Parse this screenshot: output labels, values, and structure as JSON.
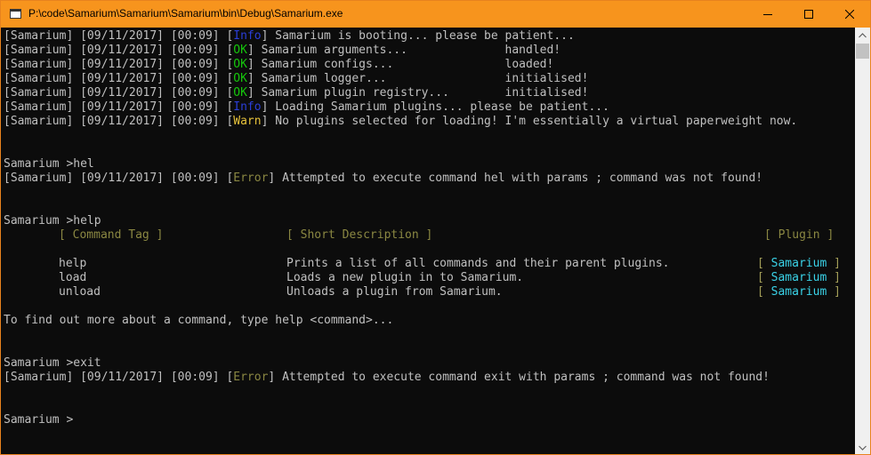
{
  "window": {
    "title": "P:\\code\\Samarium\\Samarium\\Samarium\\bin\\Debug\\Samarium.exe",
    "title_bar_color": "#f7941d",
    "buttons": {
      "minimize": "minimize-icon",
      "maximize": "maximize-icon",
      "close": "close-icon"
    }
  },
  "colors": {
    "info": "#2b3fd9",
    "ok": "#16c60c",
    "warn": "#e6c23a",
    "error": "#8a8742",
    "plugin": "#3ad3e8",
    "text": "#c0c0c0",
    "background": "#0c0c0c"
  },
  "log": {
    "prefix": "[Samarium] [09/11/2017] [00:09] ",
    "boot": [
      {
        "tag": "Info",
        "message": " Samarium is booting... please be patient..."
      },
      {
        "tag": "OK",
        "message": " Samarium arguments...              handled!"
      },
      {
        "tag": "OK",
        "message": " Samarium configs...                loaded!"
      },
      {
        "tag": "OK",
        "message": " Samarium logger...                 initialised!"
      },
      {
        "tag": "OK",
        "message": " Samarium plugin registry...        initialised!"
      },
      {
        "tag": "Info",
        "message": " Loading Samarium plugins... please be patient..."
      },
      {
        "tag": "Warn",
        "message": " No plugins selected for loading! I'm essentially a virtual paperweight now."
      }
    ]
  },
  "session": {
    "prompt1": "Samarium >hel",
    "error1_tag": "Error",
    "error1_message": " Attempted to execute command hel with params ; command was not found!",
    "prompt2": "Samarium >help",
    "help_headers": {
      "tag": "[ Command Tag ]",
      "description": "[ Short Description ]",
      "plugin": "[ Plugin ]"
    },
    "help_rows": [
      {
        "tag": "help",
        "description": "Prints a list of all commands and their parent plugins.",
        "plugin": "Samarium"
      },
      {
        "tag": "load",
        "description": "Loads a new plugin in to Samarium.",
        "plugin": "Samarium"
      },
      {
        "tag": "unload",
        "description": "Unloads a plugin from Samarium.",
        "plugin": "Samarium"
      }
    ],
    "help_footer": "To find out more about a command, type help <command>...",
    "prompt3": "Samarium >exit",
    "error2_tag": "Error",
    "error2_message": " Attempted to execute command exit with params ; command was not found!",
    "prompt_current": "Samarium > "
  },
  "scrollbar": {
    "up": "scroll-up-arrow-icon",
    "down": "scroll-down-arrow-icon"
  }
}
